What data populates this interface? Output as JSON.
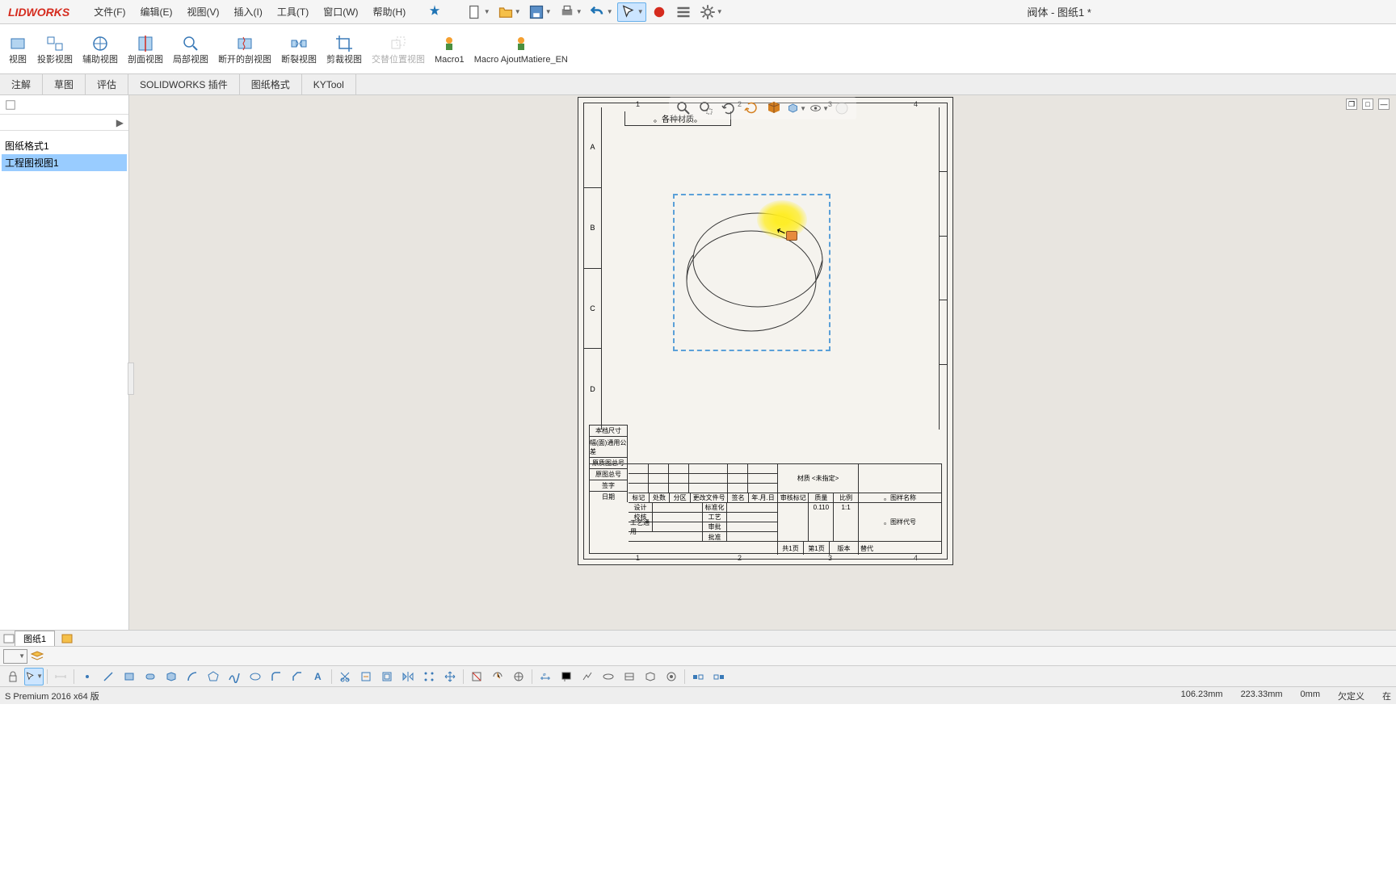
{
  "app": {
    "logo": "LIDWORKS"
  },
  "document": {
    "title": "阀体 - 图纸1 *"
  },
  "menu": {
    "file": "文件(F)",
    "edit": "编辑(E)",
    "view": "视图(V)",
    "insert": "插入(I)",
    "tools": "工具(T)",
    "window": "窗口(W)",
    "help": "帮助(H)"
  },
  "ribbon": {
    "view_btn": "视图",
    "projected": "投影视图",
    "auxiliary": "辅助视图",
    "section": "剖面视图",
    "detail": "局部视图",
    "broken_section": "断开的剖视图",
    "break": "断裂视图",
    "crop": "剪裁视图",
    "alternate": "交替位置视图",
    "macro1": "Macro1",
    "macro2": "Macro AjoutMatiere_EN"
  },
  "tabs": {
    "annotate": "注解",
    "sketch": "草图",
    "evaluate": "评估",
    "addins": "SOLIDWORKS 插件",
    "sheetformat": "图纸格式",
    "kytool": "KYTool"
  },
  "tree": {
    "root": "",
    "sheet_format": "图纸格式1",
    "drawing_view": "工程图视图1"
  },
  "sheet": {
    "title_box": "。各种材质。",
    "zones_top": [
      "1",
      "2",
      "3",
      "4"
    ],
    "zones_left": [
      "A",
      "B",
      "C",
      "D"
    ]
  },
  "title_block": {
    "left_labels": [
      "本档尺寸",
      "幅(面)通用公差",
      "原质图总号",
      "原图总号",
      "签字",
      "日期"
    ],
    "header_row": [
      "标记",
      "处数",
      "分区",
      "更改文件号",
      "签名",
      "年.月.日"
    ],
    "approval_row": [
      "审核标记",
      "质量",
      "比例"
    ],
    "scale": "1:1",
    "mass": "0.110",
    "process_rows": [
      "设计",
      "校核",
      "工艺通用"
    ],
    "process_right": [
      "标准化",
      "工艺",
      "审批",
      "批准"
    ],
    "footer": [
      "共1页",
      "第1页",
      "版本",
      "替代"
    ],
    "material": "材质 <未指定>",
    "remark1": "。图样名称",
    "remark2": "。图样代号"
  },
  "bottom_tabs": {
    "sheet1": "图纸1"
  },
  "status": {
    "version": "S Premium 2016 x64 版",
    "coord_x": "106.23mm",
    "coord_y": "223.33mm",
    "coord_z": "0mm",
    "definition": "欠定义",
    "dot": "在"
  }
}
